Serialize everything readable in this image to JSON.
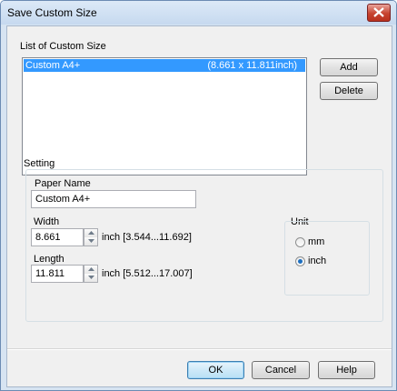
{
  "window": {
    "title": "Save Custom Size"
  },
  "list": {
    "label": "List of Custom Size",
    "items": [
      {
        "name": "Custom A4+",
        "size": "(8.661 x 11.811inch)",
        "selected": true
      }
    ]
  },
  "buttons": {
    "add": "Add",
    "delete": "Delete",
    "ok": "OK",
    "cancel": "Cancel",
    "help": "Help"
  },
  "setting": {
    "group_label": "Setting",
    "paper_name_label": "Paper Name",
    "paper_name_value": "Custom A4+",
    "width_label": "Width",
    "width_value": "8.661",
    "width_range": "inch [3.544...11.692]",
    "length_label": "Length",
    "length_value": "11.811",
    "length_range": "inch [5.512...17.007]"
  },
  "unit": {
    "label": "Unit",
    "options": [
      {
        "label": "mm",
        "selected": false
      },
      {
        "label": "inch",
        "selected": true
      }
    ]
  },
  "colors": {
    "selection": "#3399ff",
    "close_button": "#c7432f",
    "titlebar": "#c6d9ef"
  }
}
